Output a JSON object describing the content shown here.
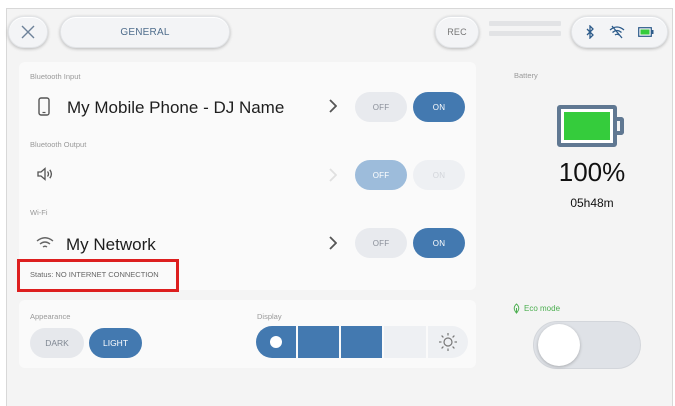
{
  "topbar": {
    "tab_label": "GENERAL",
    "rec_label": "REC",
    "icons": [
      "close-icon",
      "bluetooth-icon",
      "wifi-off-icon",
      "battery-small-icon"
    ]
  },
  "bluetooth_input": {
    "section_label": "Bluetooth Input",
    "device_name": "My Mobile Phone - DJ Name",
    "off_label": "OFF",
    "on_label": "ON",
    "state": "ON"
  },
  "bluetooth_output": {
    "section_label": "Bluetooth Output",
    "off_label": "OFF",
    "on_label": "ON",
    "state": "OFF"
  },
  "wifi": {
    "section_label": "Wi-Fi",
    "network_name": "My Network",
    "off_label": "OFF",
    "on_label": "ON",
    "state": "ON",
    "status_text": "Status: NO INTERNET CONNECTION"
  },
  "appearance": {
    "section_label": "Appearance",
    "dark_label": "DARK",
    "light_label": "LIGHT",
    "selected": "LIGHT"
  },
  "display": {
    "section_label": "Display",
    "brightness_segments_filled": 3,
    "brightness_segments_total": 4
  },
  "battery": {
    "section_label": "Battery",
    "percent": "100%",
    "time_remaining": "05h48m",
    "level": 1.0,
    "fill_color": "#35cc3c"
  },
  "eco_mode": {
    "label": "Eco mode",
    "enabled": false
  },
  "colors": {
    "accent": "#4379b0",
    "highlight_box": "#dd1f1f"
  }
}
